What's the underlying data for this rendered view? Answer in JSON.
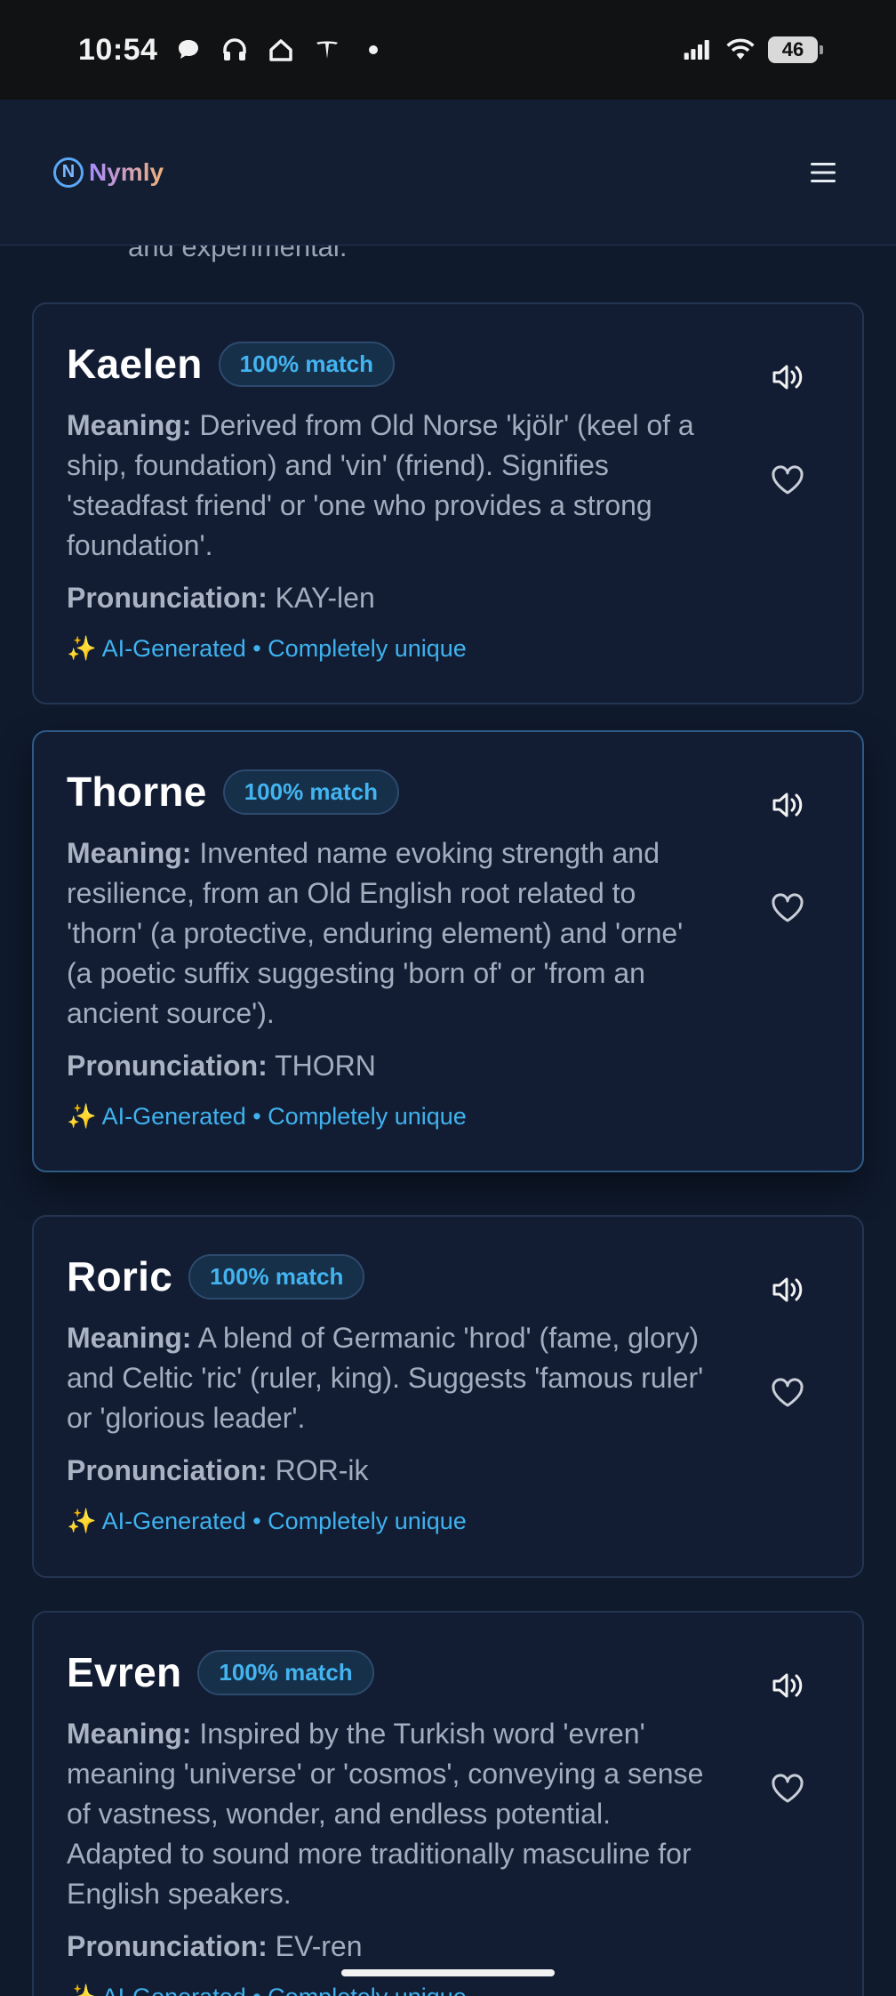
{
  "status_bar": {
    "time": "10:54",
    "battery": "46",
    "left_icons": [
      "chat-bubble-icon",
      "headphones-icon",
      "home-icon",
      "tesla-icon",
      "dot-icon"
    ],
    "right_icons": [
      "signal-icon",
      "wifi-icon",
      "battery-icon"
    ]
  },
  "header": {
    "logo_letter": "N",
    "logo_text": "Nymly",
    "menu_icon": "hamburger-menu-icon"
  },
  "previous_fragment": "and experimental.",
  "labels": {
    "meaning": "Meaning:",
    "pronunciation": "Pronunciation:",
    "tag": "✨ AI-Generated • Completely unique"
  },
  "names": [
    {
      "name": "Kaelen",
      "match": "100% match",
      "meaning": "Derived from Old Norse 'kjölr' (keel of a ship, foundation) and 'vin' (friend). Signifies 'steadfast friend' or 'one who provides a strong foundation'.",
      "pronunciation": "KAY-len"
    },
    {
      "name": "Thorne",
      "match": "100% match",
      "meaning": "Invented name evoking strength and resilience, from an Old English root related to 'thorn' (a protective, enduring element) and 'orne' (a poetic suffix suggesting 'born of' or 'from an ancient source').",
      "pronunciation": "THORN"
    },
    {
      "name": "Roric",
      "match": "100% match",
      "meaning": "A blend of Germanic 'hrod' (fame, glory) and Celtic 'ric' (ruler, king). Suggests 'famous ruler' or 'glorious leader'.",
      "pronunciation": "ROR-ik"
    },
    {
      "name": "Evren",
      "match": "100% match",
      "meaning": "Inspired by the Turkish word 'evren' meaning 'universe' or 'cosmos', conveying a sense of vastness, wonder, and endless potential. Adapted to sound more traditionally masculine for English speakers.",
      "pronunciation": "EV-ren"
    }
  ]
}
